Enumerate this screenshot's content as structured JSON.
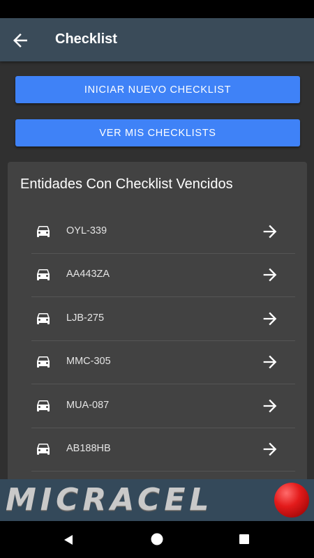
{
  "appbar": {
    "title": "Checklist",
    "back_icon": "arrow-left-icon"
  },
  "buttons": {
    "new_checklist": "INICIAR NUEVO CHECKLIST",
    "my_checklists": "VER MIS CHECKLISTS"
  },
  "card": {
    "title": "Entidades Con Checklist Vencidos",
    "items": [
      {
        "plate": "OYL-339"
      },
      {
        "plate": "AA443ZA"
      },
      {
        "plate": "LJB-275"
      },
      {
        "plate": "MMC-305"
      },
      {
        "plate": "MUA-087"
      },
      {
        "plate": "AB188HB"
      }
    ],
    "item_icon": "car-icon",
    "action_icon": "arrow-right-icon"
  },
  "banner": {
    "brand": "MICRACEL"
  },
  "colors": {
    "appbar": "#3a4b59",
    "button": "#3f82f7",
    "card": "#424242",
    "background": "#303030",
    "brand_red": "#e31b1b"
  }
}
